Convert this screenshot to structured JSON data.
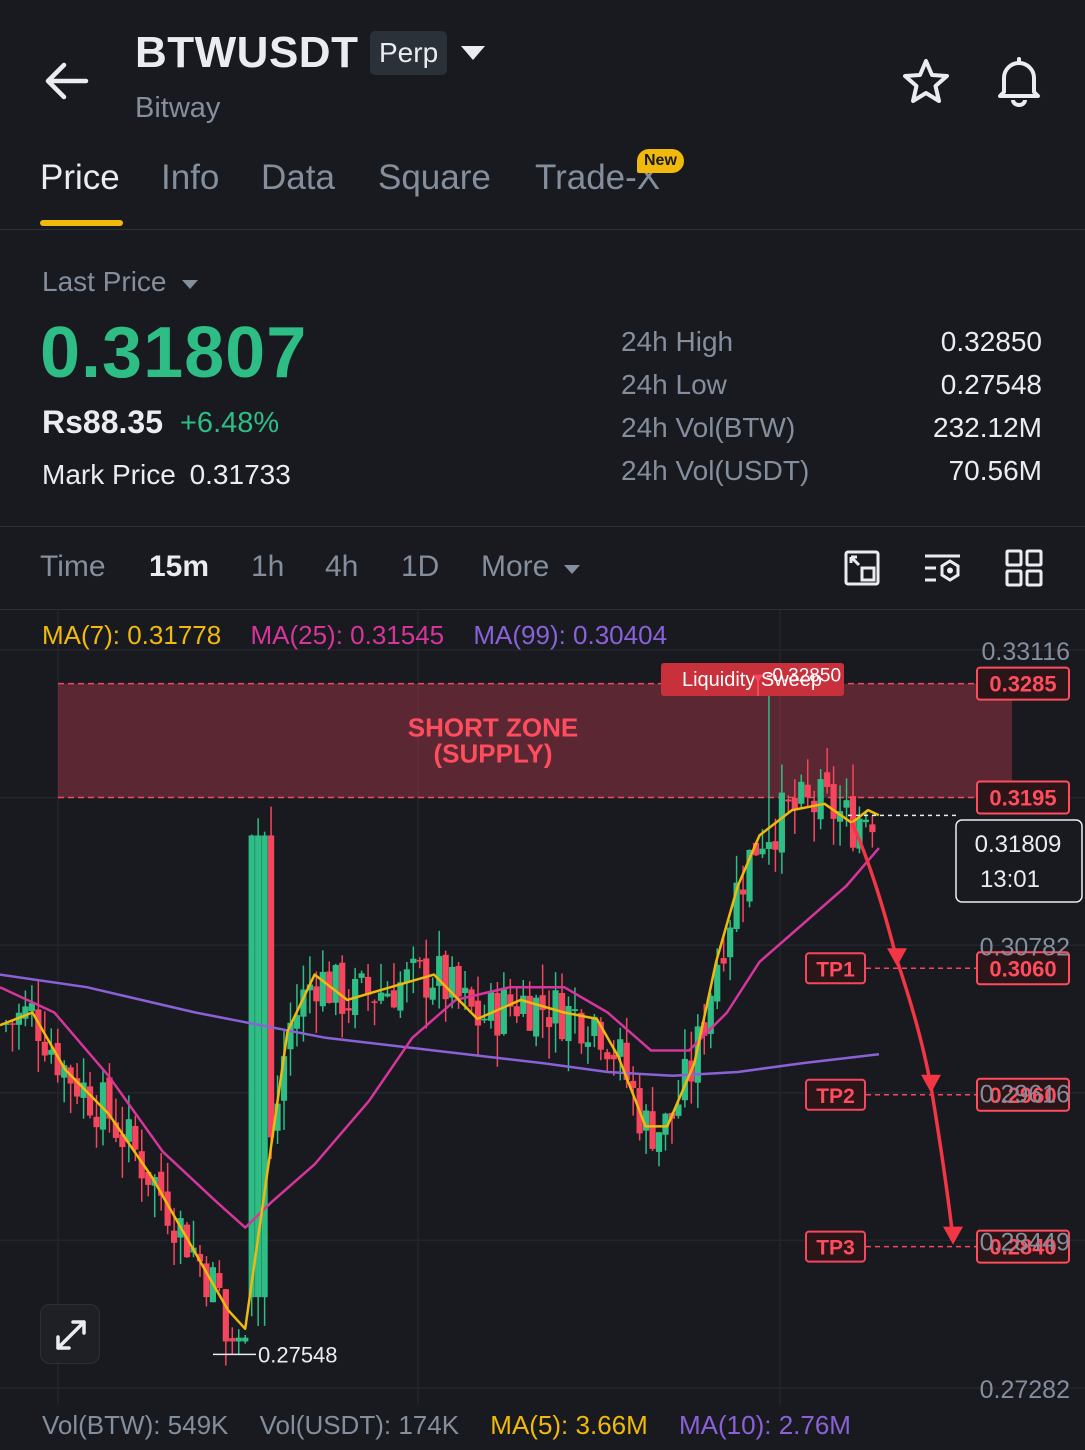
{
  "header": {
    "pair": "BTWUSDT",
    "badge": "Perp",
    "subtitle": "Bitway",
    "icons": [
      "back-arrow-icon",
      "chevron-down-icon",
      "star-icon",
      "bell-icon"
    ]
  },
  "tabs": [
    {
      "label": "Price",
      "active": true
    },
    {
      "label": "Info"
    },
    {
      "label": "Data"
    },
    {
      "label": "Square"
    },
    {
      "label": "Trade-X",
      "badge": "New"
    }
  ],
  "ticker": {
    "last_price_label": "Last Price",
    "last_price": "0.31807",
    "fiat_price": "Rs88.35",
    "change": "+6.48%",
    "mark_label": "Mark Price",
    "mark_value": "0.31733",
    "stats": [
      {
        "label": "24h High",
        "value": "0.32850"
      },
      {
        "label": "24h Low",
        "value": "0.27548"
      },
      {
        "label": "24h Vol(BTW)",
        "value": "232.12M"
      },
      {
        "label": "24h Vol(USDT)",
        "value": "70.56M"
      }
    ]
  },
  "timeframes": [
    {
      "label": "Time"
    },
    {
      "label": "15m",
      "active": true
    },
    {
      "label": "1h"
    },
    {
      "label": "4h"
    },
    {
      "label": "1D"
    },
    {
      "label": "More"
    }
  ],
  "toolbar_icons": [
    "chart-settings-icon",
    "indicator-icon",
    "grid-layout-icon"
  ],
  "indicators": {
    "ma7": "MA(7): 0.31778",
    "ma25": "MA(25): 0.31545",
    "ma99": "MA(99): 0.30404"
  },
  "volume": {
    "vol_btw": "Vol(BTW): 549K",
    "vol_usdt": "Vol(USDT): 174K",
    "ma5": "MA(5): 3.66M",
    "ma10": "MA(10): 2.76M"
  },
  "colors": {
    "up": "#2ebd85",
    "down": "#f6465d",
    "ma7": "#f0b90b",
    "ma25": "#d6359b",
    "ma99": "#8b61d8",
    "zone": "#f6465d",
    "accent": "#f0b90b"
  },
  "chart_data": {
    "type": "candlestick",
    "y_axis_ticks": [
      "0.33116",
      "0.30782",
      "0.29616",
      "0.28449",
      "0.27282"
    ],
    "ylim": [
      0.27282,
      0.33116
    ],
    "current_price": {
      "value": "0.31809",
      "countdown": "13:01"
    },
    "high_marker": "0.32850",
    "low_marker": "0.27548",
    "annotations": {
      "sweep": "Liquidity Sweep",
      "zone_line1": "SHORT ZONE",
      "zone_line2": "(SUPPLY)",
      "zone_top": "0.3285",
      "zone_bottom": "0.3195",
      "targets": [
        {
          "name": "TP1",
          "price": "0.3060"
        },
        {
          "name": "TP2",
          "price": "0.2960"
        },
        {
          "name": "TP3",
          "price": "0.2840"
        }
      ]
    },
    "ma7_path": [
      [
        0,
        0.3015
      ],
      [
        0.03,
        0.3025
      ],
      [
        0.06,
        0.298
      ],
      [
        0.1,
        0.2945
      ],
      [
        0.14,
        0.2895
      ],
      [
        0.18,
        0.2835
      ],
      [
        0.21,
        0.279
      ],
      [
        0.226,
        0.2775
      ],
      [
        0.245,
        0.289
      ],
      [
        0.265,
        0.301
      ],
      [
        0.29,
        0.3055
      ],
      [
        0.32,
        0.3035
      ],
      [
        0.36,
        0.3045
      ],
      [
        0.4,
        0.3055
      ],
      [
        0.44,
        0.302
      ],
      [
        0.48,
        0.3035
      ],
      [
        0.52,
        0.3025
      ],
      [
        0.55,
        0.302
      ],
      [
        0.57,
        0.299
      ],
      [
        0.595,
        0.2935
      ],
      [
        0.615,
        0.2935
      ],
      [
        0.64,
        0.2985
      ],
      [
        0.66,
        0.3065
      ],
      [
        0.68,
        0.3125
      ],
      [
        0.7,
        0.3165
      ],
      [
        0.73,
        0.3185
      ],
      [
        0.76,
        0.319
      ],
      [
        0.785,
        0.3175
      ],
      [
        0.8,
        0.3185
      ],
      [
        0.81,
        0.3181
      ]
    ],
    "ma25_path": [
      [
        0,
        0.3045
      ],
      [
        0.05,
        0.3025
      ],
      [
        0.1,
        0.2975
      ],
      [
        0.15,
        0.2915
      ],
      [
        0.2,
        0.2875
      ],
      [
        0.226,
        0.2855
      ],
      [
        0.25,
        0.2875
      ],
      [
        0.29,
        0.2905
      ],
      [
        0.34,
        0.2955
      ],
      [
        0.38,
        0.3005
      ],
      [
        0.42,
        0.3035
      ],
      [
        0.47,
        0.3045
      ],
      [
        0.52,
        0.3045
      ],
      [
        0.56,
        0.3025
      ],
      [
        0.6,
        0.2995
      ],
      [
        0.635,
        0.2995
      ],
      [
        0.67,
        0.3025
      ],
      [
        0.7,
        0.3065
      ],
      [
        0.74,
        0.3095
      ],
      [
        0.78,
        0.3125
      ],
      [
        0.81,
        0.3155
      ]
    ],
    "ma99_path": [
      [
        0,
        0.3055
      ],
      [
        0.08,
        0.3045
      ],
      [
        0.18,
        0.3025
      ],
      [
        0.3,
        0.3005
      ],
      [
        0.4,
        0.2995
      ],
      [
        0.5,
        0.2985
      ],
      [
        0.56,
        0.2978
      ],
      [
        0.62,
        0.2975
      ],
      [
        0.68,
        0.2978
      ],
      [
        0.74,
        0.2985
      ],
      [
        0.81,
        0.2992
      ]
    ]
  }
}
